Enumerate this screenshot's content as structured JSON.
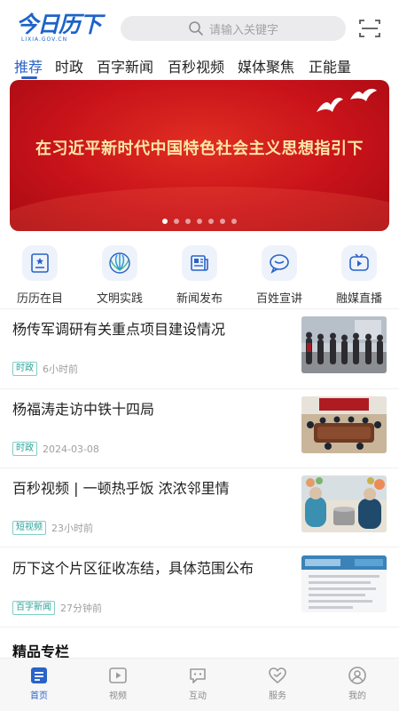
{
  "header": {
    "logo_text": "今日历下",
    "logo_sub": "LIXIA.GOV.CN",
    "search_placeholder": "请输入关键字",
    "scan_icon": "scan-icon"
  },
  "tabs": [
    {
      "label": "推荐",
      "active": true
    },
    {
      "label": "时政",
      "active": false
    },
    {
      "label": "百字新闻",
      "active": false
    },
    {
      "label": "百秒视频",
      "active": false
    },
    {
      "label": "媒体聚焦",
      "active": false
    },
    {
      "label": "正能量",
      "active": false
    }
  ],
  "banner": {
    "text": "在习近平新时代中国特色社会主义思想指引下",
    "dot_count": 7,
    "active_dot": 0
  },
  "shortcuts": [
    {
      "label": "历历在目",
      "icon": "photo-frame-icon"
    },
    {
      "label": "文明实践",
      "icon": "civilization-logo-icon"
    },
    {
      "label": "新闻发布",
      "icon": "newspaper-icon"
    },
    {
      "label": "百姓宣讲",
      "icon": "chat-bubble-icon"
    },
    {
      "label": "融媒直播",
      "icon": "live-play-icon"
    }
  ],
  "news": [
    {
      "title": "杨传军调研有关重点项目建设情况",
      "tag": "时政",
      "time": "6小时前"
    },
    {
      "title": "杨福涛走访中铁十四局",
      "tag": "时政",
      "time": "2024-03-08"
    },
    {
      "title": "百秒视频 | 一顿热乎饭 浓浓邻里情",
      "tag": "短视频",
      "time": "23小时前"
    },
    {
      "title": "历下这个片区征收冻结，具体范围公布",
      "tag": "百字新闻",
      "time": "27分钟前"
    }
  ],
  "section_title": "精品专栏",
  "bottom_nav": [
    {
      "label": "首页",
      "icon": "home-icon",
      "active": true
    },
    {
      "label": "视频",
      "icon": "video-icon",
      "active": false
    },
    {
      "label": "互动",
      "icon": "interaction-icon",
      "active": false
    },
    {
      "label": "服务",
      "icon": "service-icon",
      "active": false
    },
    {
      "label": "我的",
      "icon": "profile-icon",
      "active": false
    }
  ],
  "colors": {
    "accent": "#2a63c9",
    "banner_red": "#c8121a",
    "banner_text": "#fbe6a6",
    "tag_green": "#2aa39a"
  }
}
